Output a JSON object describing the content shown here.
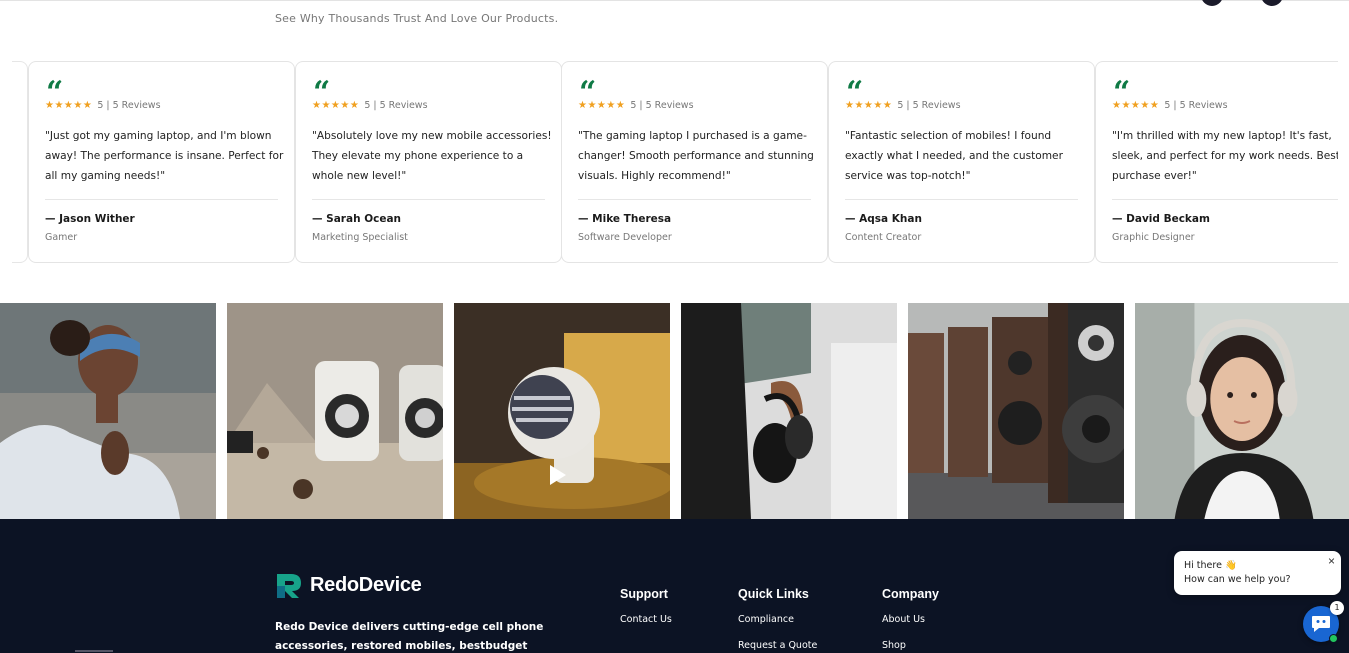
{
  "header": {
    "subtitle": "See Why Thousands Trust And Love Our Products."
  },
  "testimonials": {
    "quote_glyph": "“",
    "stars": "★★★★★",
    "items": [
      {
        "rating": "5 | 5 Reviews",
        "text": "\"Just got my gaming laptop, and I'm blown away! The performance is insane. Perfect for all my gaming needs!\"",
        "author": "— Jason Wither",
        "role": "Gamer"
      },
      {
        "rating": "5 | 5 Reviews",
        "text": "\"Absolutely love my new mobile accessories! They elevate my phone experience to a whole new level!\"",
        "author": "— Sarah Ocean",
        "role": "Marketing Specialist"
      },
      {
        "rating": "5 | 5 Reviews",
        "text": "\"The gaming laptop I purchased is a game-changer! Smooth performance and stunning visuals. Highly recommend!\"",
        "author": "— Mike Theresa",
        "role": "Software Developer"
      },
      {
        "rating": "5 | 5 Reviews",
        "text": "\"Fantastic selection of mobiles! I found exactly what I needed, and the customer service was top-notch!\"",
        "author": "— Aqsa Khan",
        "role": "Content Creator"
      },
      {
        "rating": "5 | 5 Reviews",
        "text": "\"I'm thrilled with my new laptop! It's fast, sleek, and perfect for my work needs. Best purchase ever!\"",
        "author": "— David Beckam",
        "role": "Graphic Designer"
      }
    ]
  },
  "footer": {
    "brand": "RedoDevice",
    "description": "Redo Device delivers cutting-edge cell phone accessories, restored mobiles, bestbudget laptops,",
    "columns": {
      "support": {
        "title": "Support",
        "links": [
          "Contact Us"
        ]
      },
      "quick": {
        "title": "Quick Links",
        "links": [
          "Compliance",
          "Request a Quote"
        ]
      },
      "company": {
        "title": "Company",
        "links": [
          "About Us",
          "Shop"
        ]
      }
    }
  },
  "chat": {
    "greeting": "Hi there 👋",
    "prompt": "How can we help you?",
    "close": "×",
    "badge": "1"
  },
  "colors": {
    "accent_green": "#0f7a45",
    "star": "#f0a020",
    "footer_bg": "#0c1324",
    "chat_blue": "#1966d2"
  }
}
